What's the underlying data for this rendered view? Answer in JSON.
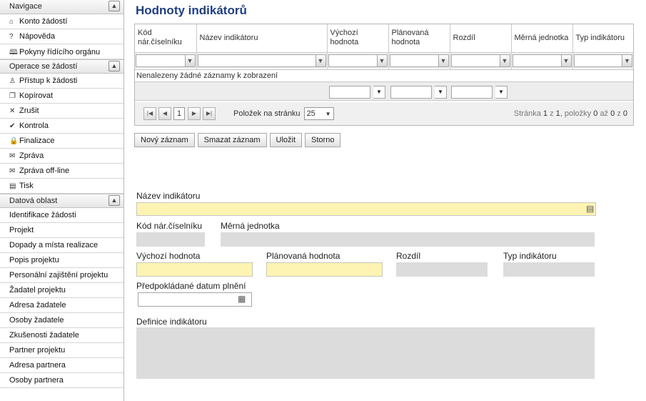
{
  "sidebar": {
    "sections": [
      {
        "title": "Navigace",
        "items": [
          {
            "label": "Konto žádostí",
            "icon": "home-icon",
            "glyph": "⌂"
          },
          {
            "label": "Nápověda",
            "icon": "help-icon",
            "glyph": "?"
          },
          {
            "label": "Pokyny řídícího orgánu",
            "icon": "book-icon",
            "glyph": "🕮"
          }
        ]
      },
      {
        "title": "Operace se žádostí",
        "items": [
          {
            "label": "Přístup k žádosti",
            "icon": "user-access-icon",
            "glyph": "♙"
          },
          {
            "label": "Kopírovat",
            "icon": "copy-icon",
            "glyph": "❐"
          },
          {
            "label": "Zrušit",
            "icon": "cancel-icon",
            "glyph": "✕"
          },
          {
            "label": "Kontrola",
            "icon": "check-icon",
            "glyph": "✔"
          },
          {
            "label": "Finalizace",
            "icon": "lock-icon",
            "glyph": "🔒"
          },
          {
            "label": "Zpráva",
            "icon": "message-icon",
            "glyph": "✉"
          },
          {
            "label": "Zpráva off-line",
            "icon": "offline-message-icon",
            "glyph": "✉"
          },
          {
            "label": "Tisk",
            "icon": "print-icon",
            "glyph": "▤"
          }
        ]
      },
      {
        "title": "Datová oblast",
        "items": [
          {
            "label": "Identifikace žádosti"
          },
          {
            "label": "Projekt"
          },
          {
            "label": "Dopady a místa realizace"
          },
          {
            "label": "Popis projektu"
          },
          {
            "label": "Personální zajištění projektu"
          },
          {
            "label": "Žadatel projektu"
          },
          {
            "label": "Adresa žadatele"
          },
          {
            "label": "Osoby žadatele"
          },
          {
            "label": "Zkušenosti žadatele"
          },
          {
            "label": "Partner projektu"
          },
          {
            "label": "Adresa partnera"
          },
          {
            "label": "Osoby partnera"
          }
        ]
      }
    ]
  },
  "main": {
    "title": "Hodnoty indikátorů",
    "grid": {
      "columns": [
        "Kód nár.číselníku",
        "Název indikátoru",
        "Výchozí hodnota",
        "Plánovaná hodnota",
        "Rozdíl",
        "Měrná jednotka",
        "Typ indikátoru"
      ],
      "empty_message": "Nenalezeny žádné záznamy k zobrazení",
      "pager": {
        "page": "1",
        "page_size_label": "Položek na stránku",
        "page_size": "25",
        "info_prefix": "Stránka",
        "page_current": "1",
        "info_of": "z",
        "page_total": "1",
        "info_items": ", položky",
        "item_from": "0",
        "info_to": "až",
        "item_to": "0",
        "info_z": "z",
        "item_total": "0"
      }
    },
    "buttons": {
      "new": "Nový záznam",
      "delete": "Smazat záznam",
      "save": "Uložit",
      "cancel": "Storno"
    },
    "form": {
      "name_label": "Název indikátoru",
      "code_label": "Kód nár.číselníku",
      "unit_label": "Měrná jednotka",
      "initial_label": "Výchozí hodnota",
      "planned_label": "Plánovaná hodnota",
      "diff_label": "Rozdíl",
      "type_label": "Typ indikátoru",
      "date_label": "Předpokládané datum plnění",
      "definition_label": "Definice indikátoru"
    }
  }
}
